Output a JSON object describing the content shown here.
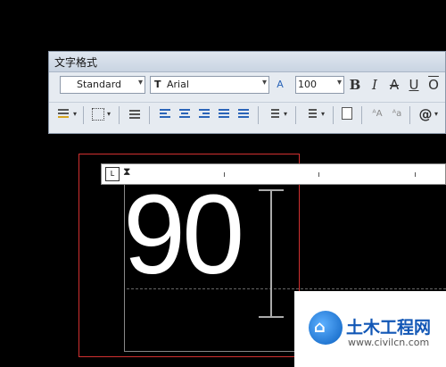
{
  "window": {
    "title": "文字格式"
  },
  "toolbar": {
    "style_value": "Standard",
    "font_icon_text": "T",
    "font_value": "Arial",
    "height_value": "100",
    "bold_label": "B",
    "italic_label": "I",
    "strike_label": "A",
    "underline_label": "U",
    "overline_label": "O",
    "at_label": "@"
  },
  "ruler": {
    "tab_label": "L"
  },
  "canvas": {
    "text": "90"
  },
  "watermark": {
    "title": "土木工程网",
    "url": "www.civilcn.com"
  },
  "colors": {
    "accent": "#1257b6",
    "frame": "#d03030"
  }
}
